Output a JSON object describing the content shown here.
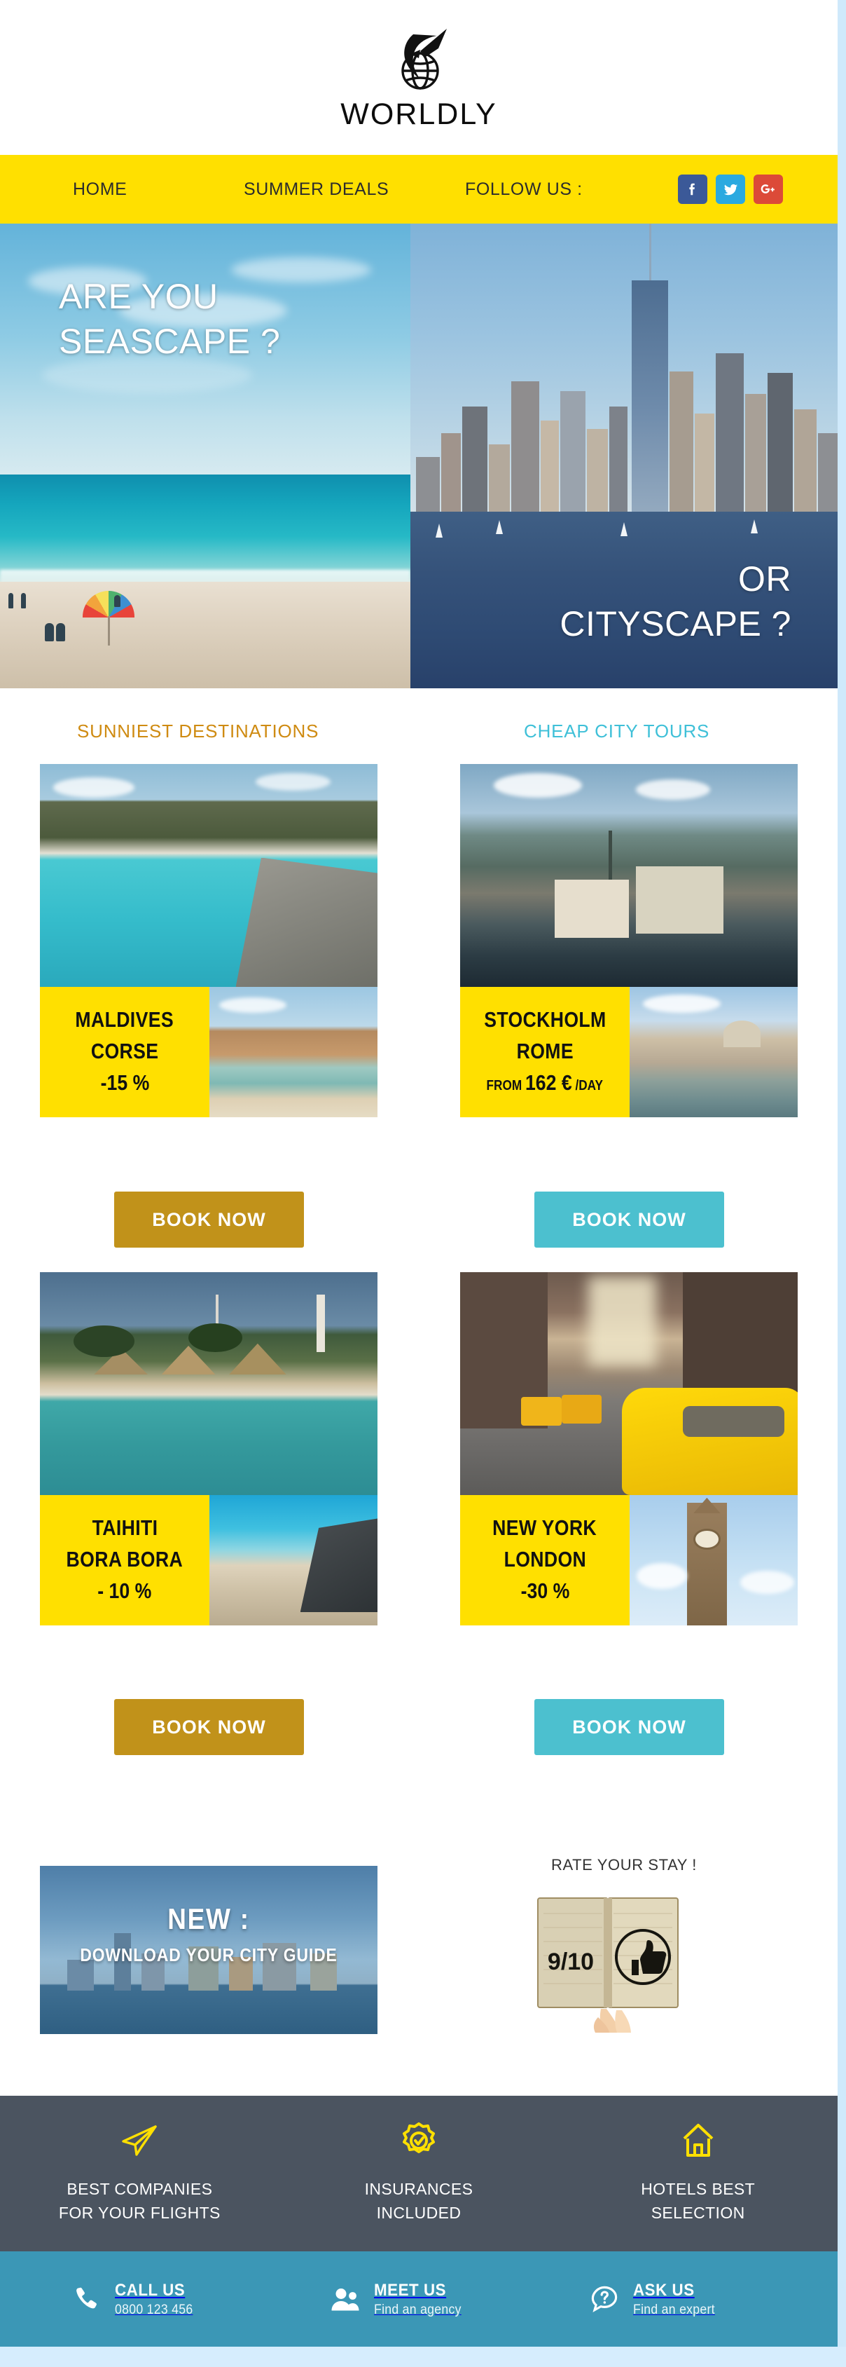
{
  "brand": {
    "name": "WORLDLY",
    "logo_icon": "globe-airplane-icon"
  },
  "nav": {
    "items": [
      {
        "label": "HOME",
        "name": "nav-home"
      },
      {
        "label": "SUMMER DEALS",
        "name": "nav-summer-deals"
      },
      {
        "label": "FOLLOW US :",
        "name": "nav-follow-us"
      }
    ],
    "socials": [
      {
        "name": "facebook-icon",
        "label": "f",
        "color": "#3b5998"
      },
      {
        "name": "twitter-icon",
        "label": "t",
        "color": "#2aa9e0"
      },
      {
        "name": "google-plus-icon",
        "label": "G+",
        "color": "#dc4a38"
      }
    ],
    "background": "#ffe000"
  },
  "hero": {
    "left_text": "ARE YOU\nSEASCAPE ?",
    "right_text": "OR\nCITYSCAPE ?"
  },
  "columns": {
    "sun": {
      "heading": "SUNNIEST DESTINATIONS",
      "color": "#cf8b12",
      "button_color": "#c1921a"
    },
    "city": {
      "heading": "CHEAP CITY TOURS",
      "color": "#3fc0d8",
      "button_color": "#4cc0cf"
    }
  },
  "cards": [
    {
      "name": "card-maldives-corse",
      "column": "sun",
      "lines": [
        "MALDIVES",
        "CORSE"
      ],
      "price": "-15 %",
      "price_prefix": "",
      "price_suffix": "",
      "button": "BOOK NOW"
    },
    {
      "name": "card-stockholm-rome",
      "column": "city",
      "lines": [
        "STOCKHOLM",
        "ROME"
      ],
      "price": "162 €",
      "price_prefix": "FROM ",
      "price_suffix": " /DAY",
      "button": "BOOK NOW"
    },
    {
      "name": "card-taihiti-bora-bora",
      "column": "sun",
      "lines": [
        "TAIHITI",
        "BORA BORA"
      ],
      "price": "- 10 %",
      "price_prefix": "",
      "price_suffix": "",
      "button": "BOOK NOW"
    },
    {
      "name": "card-new-york-london",
      "column": "city",
      "lines": [
        "NEW YORK",
        "LONDON"
      ],
      "price": "-30 %",
      "price_prefix": "",
      "price_suffix": "",
      "button": "BOOK NOW"
    }
  ],
  "promo": {
    "title": "NEW :",
    "subtitle": "DOWNLOAD YOUR CITY GUIDE"
  },
  "rating": {
    "title": "RATE YOUR STAY !",
    "score": "9/10",
    "icon": "thumbs-up-icon"
  },
  "features": {
    "background": "#4b5460",
    "icon_color": "#ffe000",
    "items": [
      {
        "icon": "paper-plane-icon",
        "label": "BEST COMPANIES\nFOR YOUR FLIGHTS"
      },
      {
        "icon": "badge-check-icon",
        "label": "INSURANCES\nINCLUDED"
      },
      {
        "icon": "home-icon",
        "label": "HOTELS BEST\nSELECTION"
      }
    ]
  },
  "contact": {
    "background": "#3b97b6",
    "items": [
      {
        "icon": "phone-icon",
        "title": "CALL US",
        "sub": "0800 123 456"
      },
      {
        "icon": "people-icon",
        "title": "MEET US",
        "sub": "Find an agency"
      },
      {
        "icon": "question-bubble-icon",
        "title": "ASK US",
        "sub": "Find an expert"
      }
    ]
  }
}
